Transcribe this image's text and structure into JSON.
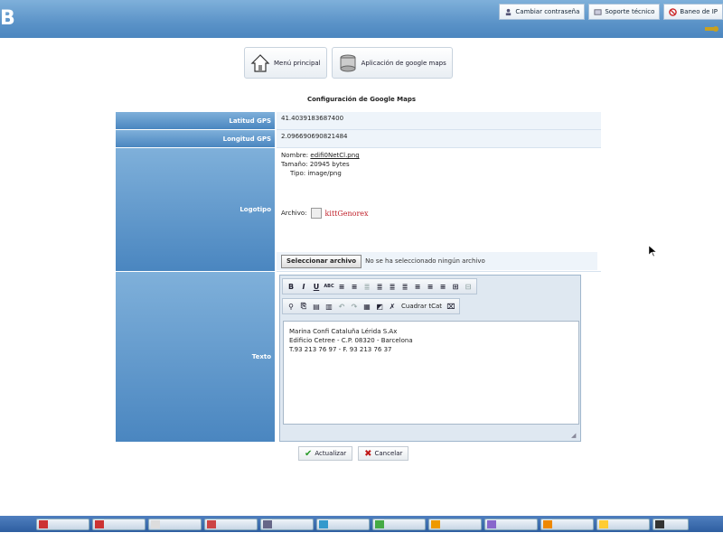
{
  "header": {
    "logo_text": "B",
    "links": [
      {
        "label": "Cambiar contraseña",
        "icon": "user-key-icon"
      },
      {
        "label": "Soporte técnico",
        "icon": "support-icon"
      },
      {
        "label": "Baneo de IP",
        "icon": "ban-icon"
      }
    ]
  },
  "nav": {
    "items": [
      {
        "label": "Menú principal",
        "icon": "home-icon"
      },
      {
        "label": "Aplicación de google maps",
        "icon": "database-icon"
      }
    ]
  },
  "page_title": "Configuración de Google Maps",
  "form": {
    "lat_label": "Latitud GPS",
    "lat_value": "41.4039183687400",
    "lng_label": "Longitud GPS",
    "lng_value": "2.096690690821484",
    "logo_label": "Logotipo",
    "logo_info": {
      "line1_prefix": "Nombre: ",
      "line1_link": "edifi0NetCl.png",
      "line2": "Tamaño: 20945 bytes",
      "line3": "Tipo: image/png"
    },
    "preview_label": "Archivo:",
    "preview_brand": "kittGenorex",
    "file_button": "Seleccionar archivo",
    "file_status": "No se ha seleccionado ningún archivo",
    "text_label": "Texto",
    "editor_lines": [
      "Marina Confi Cataluña Lérida S.Ax",
      "Edificio Cetree - C.P. 08320 - Barcelona",
      "T.93 213 76 97 - F. 93 213 76 37"
    ],
    "toolbar1": [
      "B",
      "I",
      "U",
      "ABC",
      "≡",
      "≡",
      "≣",
      "≣",
      "≣",
      "≣",
      "≡",
      "≡",
      "≡",
      "⊞",
      "⊟"
    ],
    "toolbar2_end": "Cuadrar tCat"
  },
  "actions": {
    "save": "Actualizar",
    "cancel": "Cancelar"
  },
  "colors": {
    "header": "#5b93c8",
    "label_bg": "#4a86c0",
    "value_bg": "#eef4fa",
    "taskbar": "#2e5ea0"
  }
}
